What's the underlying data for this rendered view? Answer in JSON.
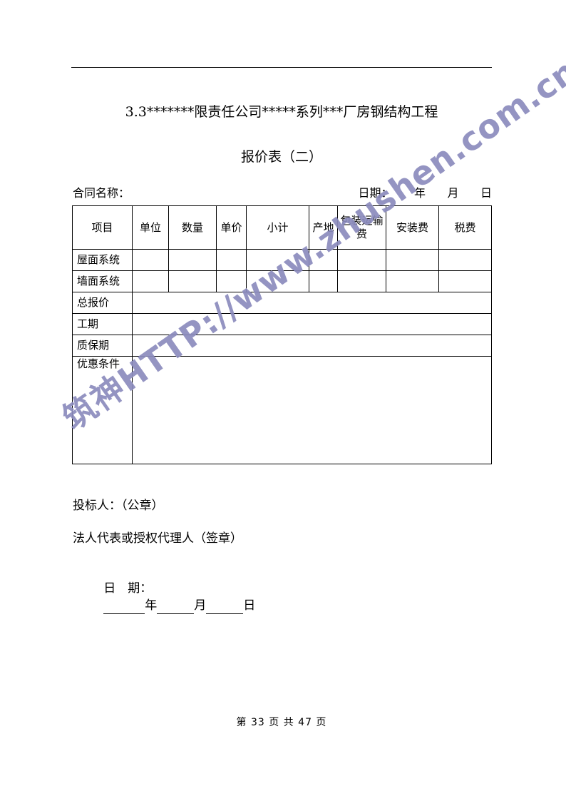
{
  "document": {
    "title": "3.3*******限责任公司*****系列***厂房钢结构工程",
    "subtitle": "报价表（二）",
    "contract_label": "合同名称：",
    "date_label": "日期：      年      月      日"
  },
  "table": {
    "headers": [
      "项目",
      "单位",
      "数量",
      "单价",
      "小计",
      "产地",
      "包装运输费",
      "安装费",
      "税费"
    ],
    "item_rows": [
      {
        "label": "屋面系统"
      },
      {
        "label": "墙面系统"
      }
    ],
    "summary_rows": [
      {
        "label": "总报价",
        "value": ""
      },
      {
        "label": "工期",
        "value": ""
      },
      {
        "label": "质保期",
        "value": ""
      },
      {
        "label": "优惠条件",
        "value": ""
      }
    ]
  },
  "signature": {
    "bidder": "投标人：（公章）",
    "representative": "法人代表或授权代理人（签章）",
    "date_prefix": "日　期：",
    "year_unit": "年",
    "month_unit": "月",
    "day_unit": "日"
  },
  "footer": {
    "page_text": "第 33 页 共 47 页"
  },
  "watermark": {
    "text": "筑神HTTP://www.zhushen.com.cn",
    "color": "#8b8bbd"
  }
}
